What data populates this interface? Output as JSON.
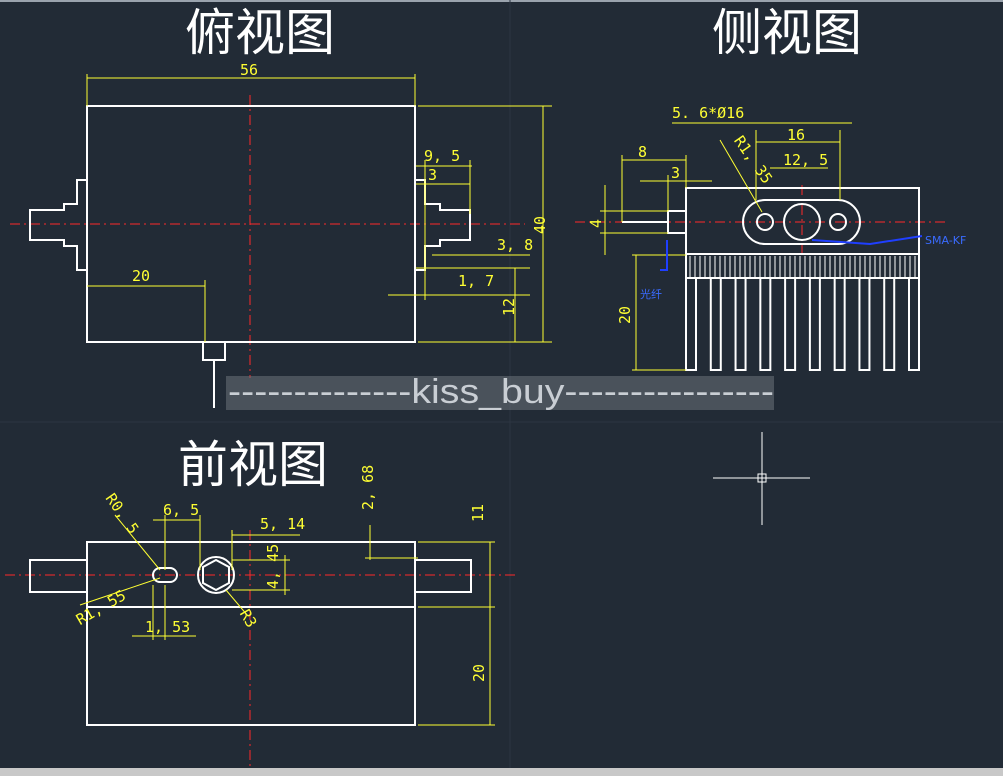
{
  "titles": {
    "top_view": "俯视图",
    "side_view": "侧视图",
    "front_view": "前视图"
  },
  "watermark": "--------------kiss_buy----------------",
  "top_view_dims": {
    "width": "56",
    "height": "40",
    "d_9_5": "9, 5",
    "d_3": "3",
    "d_3_8": "3, 8",
    "d_1_7": "1, 7",
    "d_20": "20",
    "d_12": "12"
  },
  "side_view_dims": {
    "hole_note": "5. 6*Ø16",
    "d_16": "16",
    "d_12_5": "12, 5",
    "d_8": "8",
    "d_3": "3",
    "d_4": "4",
    "r_1_35": "R1, 35",
    "d_20": "20",
    "blue_label_right": "SMA-KF",
    "blue_label_left": "光纤"
  },
  "front_view_dims": {
    "r_0_5": "R0, 5",
    "d_6_5": "6, 5",
    "d_5_14": "5, 14",
    "d_2_68": "2, 68",
    "d_11": "11",
    "d_4_45": "4, 45",
    "r_1_55": "R1, 55",
    "d_1_53": "1, 53",
    "r_3": "R3",
    "d_20": "20"
  },
  "colors": {
    "background": "#222b36",
    "outline": "#ffffff",
    "dimension": "#ffff33",
    "centerline": "#ff2a2a",
    "leader_blue": "#1f3fff"
  }
}
